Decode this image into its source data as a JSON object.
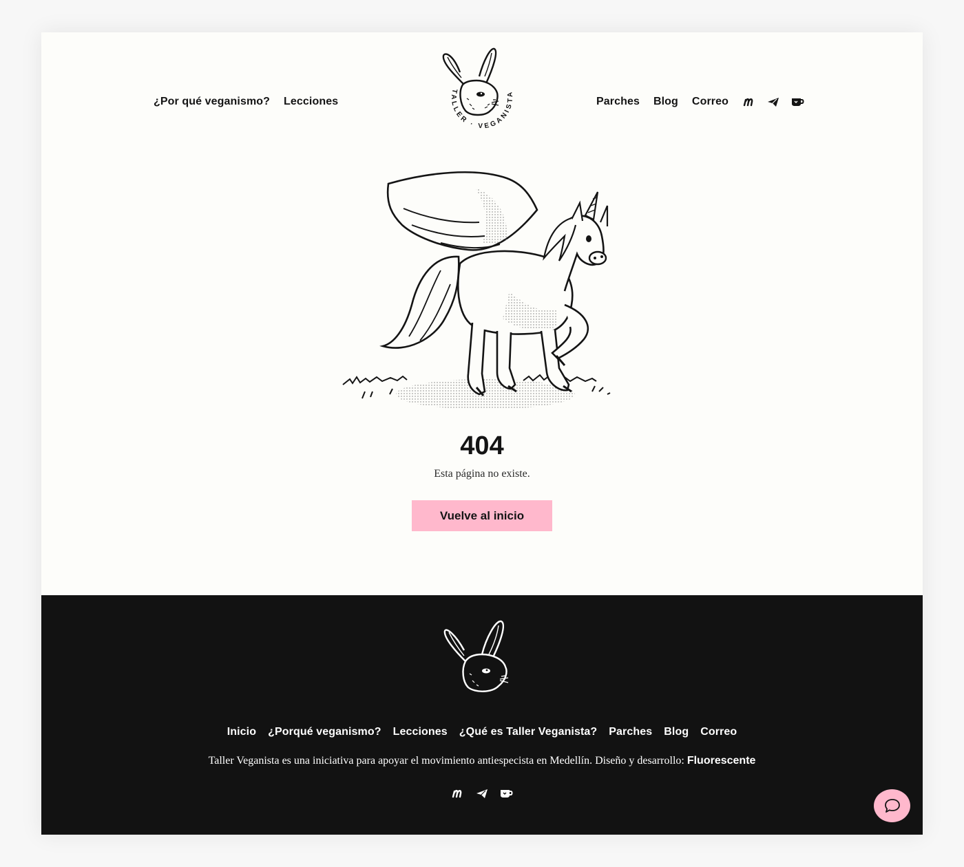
{
  "header": {
    "nav_left": [
      "¿Por qué veganismo?",
      "Lecciones"
    ],
    "nav_right": [
      "Parches",
      "Blog",
      "Correo"
    ],
    "logo_ring_text": "TALLER · VEGANISTA",
    "social_icons": [
      "medium-icon",
      "telegram-icon",
      "kofi-cup-icon"
    ]
  },
  "main": {
    "error_code": "404",
    "error_message": "Esta página no existe.",
    "home_button": "Vuelve al inicio"
  },
  "footer": {
    "nav": [
      "Inicio",
      "¿Porqué veganismo?",
      "Lecciones",
      "¿Qué es Taller Veganista?",
      "Parches",
      "Blog",
      "Correo"
    ],
    "description": "Taller Veganista es una iniciativa para apoyar el movimiento antiespecista en Medellín. Diseño y desarrollo: ",
    "credit": "Fluorescente",
    "social_icons": [
      "medium-icon",
      "telegram-icon",
      "kofi-cup-icon"
    ]
  },
  "colors": {
    "accent_pink": "#ffb8cc",
    "footer_bg": "#121212",
    "page_bg": "#fdfdfa"
  }
}
